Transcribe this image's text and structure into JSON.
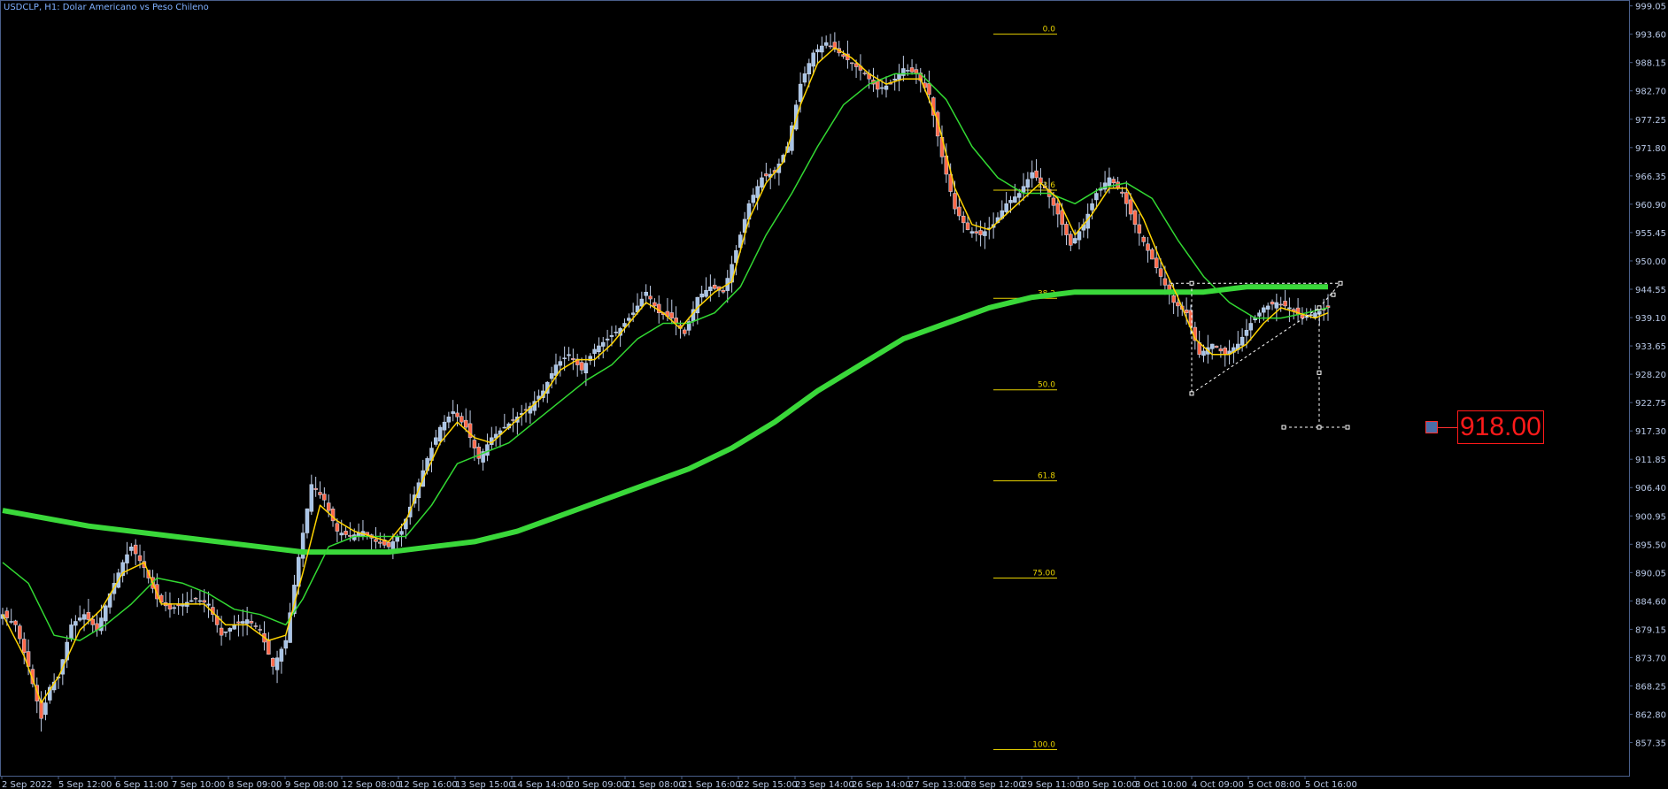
{
  "window": {
    "title": "USDCLP, H1:  Dolar Americano vs Peso Chileno"
  },
  "price_label": {
    "text": "918.00",
    "color": "#ff1a1a"
  },
  "colors": {
    "background": "#000000",
    "axis": "#4a5f8a",
    "bull_candle": "#a8c4e6",
    "bear_candle": "#ff6a4a",
    "ma_fast": "#ffd400",
    "ma_mid": "#32d832",
    "ma_slow": "#3ad83a",
    "fib": "#e8d200",
    "pattern": "#ffffff"
  },
  "chart_data": {
    "type": "candlestick",
    "symbol": "USDCLP",
    "timeframe": "H1",
    "ylim": [
      852.0,
      999.5
    ],
    "y_ticks": [
      "999.05",
      "993.60",
      "988.15",
      "982.70",
      "977.25",
      "971.80",
      "966.35",
      "960.90",
      "955.45",
      "950.00",
      "944.55",
      "939.10",
      "933.65",
      "928.20",
      "922.75",
      "917.30",
      "911.85",
      "906.40",
      "900.95",
      "895.50",
      "890.05",
      "884.60",
      "879.15",
      "873.70",
      "868.25",
      "862.80",
      "857.35"
    ],
    "x_ticks": [
      "2 Sep 2022",
      "5 Sep 12:00",
      "6 Sep 11:00",
      "7 Sep 10:00",
      "8 Sep 09:00",
      "9 Sep 08:00",
      "12 Sep 08:00",
      "12 Sep 16:00",
      "13 Sep 15:00",
      "14 Sep 14:00",
      "20 Sep 09:00",
      "21 Sep 08:00",
      "21 Sep 16:00",
      "22 Sep 15:00",
      "23 Sep 14:00",
      "26 Sep 14:00",
      "27 Sep 13:00",
      "28 Sep 12:00",
      "29 Sep 11:00",
      "30 Sep 10:00",
      "3 Oct 10:00",
      "4 Oct 09:00",
      "5 Oct 08:00",
      "5 Oct 16:00"
    ],
    "close_path": [
      [
        0,
        882
      ],
      [
        3,
        880
      ],
      [
        6,
        872
      ],
      [
        9,
        862
      ],
      [
        11,
        868
      ],
      [
        13,
        870
      ],
      [
        16,
        880
      ],
      [
        19,
        882
      ],
      [
        22,
        879
      ],
      [
        25,
        886
      ],
      [
        28,
        892
      ],
      [
        30,
        895
      ],
      [
        33,
        891
      ],
      [
        36,
        885
      ],
      [
        39,
        883
      ],
      [
        42,
        884
      ],
      [
        45,
        885
      ],
      [
        48,
        884
      ],
      [
        51,
        878
      ],
      [
        54,
        880
      ],
      [
        57,
        881
      ],
      [
        60,
        879
      ],
      [
        63,
        872
      ],
      [
        66,
        877
      ],
      [
        69,
        893
      ],
      [
        72,
        907
      ],
      [
        75,
        904
      ],
      [
        78,
        898
      ],
      [
        81,
        897
      ],
      [
        84,
        898
      ],
      [
        87,
        896
      ],
      [
        90,
        895
      ],
      [
        93,
        898
      ],
      [
        96,
        905
      ],
      [
        99,
        912
      ],
      [
        102,
        918
      ],
      [
        105,
        921
      ],
      [
        108,
        918
      ],
      [
        111,
        912
      ],
      [
        114,
        916
      ],
      [
        117,
        918
      ],
      [
        120,
        920
      ],
      [
        123,
        922
      ],
      [
        126,
        925
      ],
      [
        129,
        930
      ],
      [
        132,
        932
      ],
      [
        135,
        929
      ],
      [
        138,
        933
      ],
      [
        141,
        935
      ],
      [
        144,
        937
      ],
      [
        147,
        940
      ],
      [
        150,
        944
      ],
      [
        153,
        940
      ],
      [
        156,
        939
      ],
      [
        159,
        936
      ],
      [
        162,
        943
      ],
      [
        165,
        945
      ],
      [
        168,
        944
      ],
      [
        171,
        952
      ],
      [
        174,
        961
      ],
      [
        177,
        966
      ],
      [
        180,
        967
      ],
      [
        183,
        972
      ],
      [
        186,
        984
      ],
      [
        189,
        990
      ],
      [
        192,
        992
      ],
      [
        195,
        990
      ],
      [
        198,
        988
      ],
      [
        201,
        986
      ],
      [
        204,
        983
      ],
      [
        207,
        984
      ],
      [
        210,
        987
      ],
      [
        213,
        986
      ],
      [
        216,
        982
      ],
      [
        219,
        970
      ],
      [
        222,
        960
      ],
      [
        225,
        956
      ],
      [
        228,
        955
      ],
      [
        231,
        957
      ],
      [
        234,
        961
      ],
      [
        237,
        963
      ],
      [
        240,
        967
      ],
      [
        243,
        964
      ],
      [
        246,
        959
      ],
      [
        249,
        953
      ],
      [
        252,
        957
      ],
      [
        255,
        963
      ],
      [
        258,
        966
      ],
      [
        261,
        963
      ],
      [
        264,
        957
      ],
      [
        267,
        952
      ],
      [
        270,
        947
      ],
      [
        273,
        942
      ],
      [
        276,
        940
      ],
      [
        279,
        932
      ],
      [
        282,
        934
      ],
      [
        285,
        932
      ],
      [
        288,
        934
      ],
      [
        291,
        938
      ],
      [
        294,
        941
      ],
      [
        297,
        942
      ],
      [
        300,
        941
      ],
      [
        303,
        939
      ],
      [
        306,
        940
      ],
      [
        309,
        941
      ]
    ],
    "ma_fast_path": [
      [
        0,
        882
      ],
      [
        5,
        874
      ],
      [
        9,
        865
      ],
      [
        13,
        870
      ],
      [
        18,
        879
      ],
      [
        23,
        883
      ],
      [
        28,
        890
      ],
      [
        33,
        892
      ],
      [
        37,
        884
      ],
      [
        42,
        884
      ],
      [
        47,
        884
      ],
      [
        52,
        880
      ],
      [
        57,
        880
      ],
      [
        62,
        877
      ],
      [
        66,
        878
      ],
      [
        70,
        890
      ],
      [
        74,
        903
      ],
      [
        78,
        900
      ],
      [
        82,
        898
      ],
      [
        86,
        897
      ],
      [
        90,
        896
      ],
      [
        94,
        900
      ],
      [
        98,
        908
      ],
      [
        102,
        915
      ],
      [
        106,
        919
      ],
      [
        110,
        916
      ],
      [
        114,
        915
      ],
      [
        118,
        918
      ],
      [
        122,
        921
      ],
      [
        126,
        924
      ],
      [
        130,
        929
      ],
      [
        134,
        931
      ],
      [
        138,
        931
      ],
      [
        142,
        934
      ],
      [
        146,
        938
      ],
      [
        150,
        942
      ],
      [
        154,
        940
      ],
      [
        158,
        937
      ],
      [
        162,
        941
      ],
      [
        166,
        944
      ],
      [
        170,
        946
      ],
      [
        174,
        958
      ],
      [
        178,
        965
      ],
      [
        182,
        969
      ],
      [
        186,
        980
      ],
      [
        190,
        988
      ],
      [
        194,
        991
      ],
      [
        198,
        989
      ],
      [
        202,
        986
      ],
      [
        206,
        984
      ],
      [
        210,
        985
      ],
      [
        214,
        985
      ],
      [
        218,
        977
      ],
      [
        222,
        964
      ],
      [
        226,
        957
      ],
      [
        230,
        956
      ],
      [
        234,
        959
      ],
      [
        238,
        962
      ],
      [
        242,
        965
      ],
      [
        246,
        962
      ],
      [
        250,
        955
      ],
      [
        254,
        959
      ],
      [
        258,
        964
      ],
      [
        262,
        964
      ],
      [
        266,
        958
      ],
      [
        270,
        950
      ],
      [
        274,
        943
      ],
      [
        278,
        935
      ],
      [
        282,
        932
      ],
      [
        286,
        932
      ],
      [
        290,
        934
      ],
      [
        294,
        938
      ],
      [
        298,
        941
      ],
      [
        302,
        940
      ],
      [
        306,
        939
      ],
      [
        309,
        940
      ]
    ],
    "ma_mid_path": [
      [
        0,
        892
      ],
      [
        6,
        888
      ],
      [
        12,
        878
      ],
      [
        18,
        877
      ],
      [
        24,
        880
      ],
      [
        30,
        884
      ],
      [
        36,
        889
      ],
      [
        42,
        888
      ],
      [
        48,
        886
      ],
      [
        54,
        883
      ],
      [
        60,
        882
      ],
      [
        66,
        880
      ],
      [
        70,
        885
      ],
      [
        76,
        895
      ],
      [
        82,
        897
      ],
      [
        88,
        897
      ],
      [
        94,
        897
      ],
      [
        100,
        903
      ],
      [
        106,
        911
      ],
      [
        112,
        913
      ],
      [
        118,
        915
      ],
      [
        124,
        919
      ],
      [
        130,
        923
      ],
      [
        136,
        927
      ],
      [
        142,
        930
      ],
      [
        148,
        935
      ],
      [
        154,
        938
      ],
      [
        160,
        938
      ],
      [
        166,
        940
      ],
      [
        172,
        945
      ],
      [
        178,
        955
      ],
      [
        184,
        963
      ],
      [
        190,
        972
      ],
      [
        196,
        980
      ],
      [
        202,
        984
      ],
      [
        208,
        986
      ],
      [
        214,
        986
      ],
      [
        220,
        981
      ],
      [
        226,
        972
      ],
      [
        232,
        966
      ],
      [
        238,
        963
      ],
      [
        244,
        963
      ],
      [
        250,
        961
      ],
      [
        256,
        964
      ],
      [
        262,
        965
      ],
      [
        268,
        962
      ],
      [
        274,
        954
      ],
      [
        280,
        947
      ],
      [
        286,
        942
      ],
      [
        292,
        939
      ],
      [
        298,
        939
      ],
      [
        304,
        940
      ],
      [
        309,
        941
      ]
    ],
    "ma_slow_path": [
      [
        0,
        902
      ],
      [
        20,
        899
      ],
      [
        40,
        897
      ],
      [
        60,
        895
      ],
      [
        70,
        894
      ],
      [
        80,
        894
      ],
      [
        90,
        894
      ],
      [
        100,
        895
      ],
      [
        110,
        896
      ],
      [
        120,
        898
      ],
      [
        130,
        901
      ],
      [
        140,
        904
      ],
      [
        150,
        907
      ],
      [
        160,
        910
      ],
      [
        170,
        914
      ],
      [
        180,
        919
      ],
      [
        190,
        925
      ],
      [
        200,
        930
      ],
      [
        210,
        935
      ],
      [
        220,
        938
      ],
      [
        230,
        941
      ],
      [
        240,
        943
      ],
      [
        250,
        944
      ],
      [
        260,
        944
      ],
      [
        270,
        944
      ],
      [
        280,
        944
      ],
      [
        290,
        945
      ],
      [
        300,
        945
      ],
      [
        309,
        945
      ]
    ],
    "fibonacci": {
      "levels": [
        {
          "label": "0.0",
          "price": 993.6
        },
        {
          "label": "23.6",
          "price": 963.6
        },
        {
          "label": "38.2",
          "price": 942.8
        },
        {
          "label": "50.0",
          "price": 925.2
        },
        {
          "label": "61.8",
          "price": 907.7
        },
        {
          "label": "75.00",
          "price": 889.0
        },
        {
          "label": "100.0",
          "price": 856.0
        }
      ]
    },
    "pattern": {
      "top_line_price": 945.7,
      "target_price": 918.0
    }
  }
}
